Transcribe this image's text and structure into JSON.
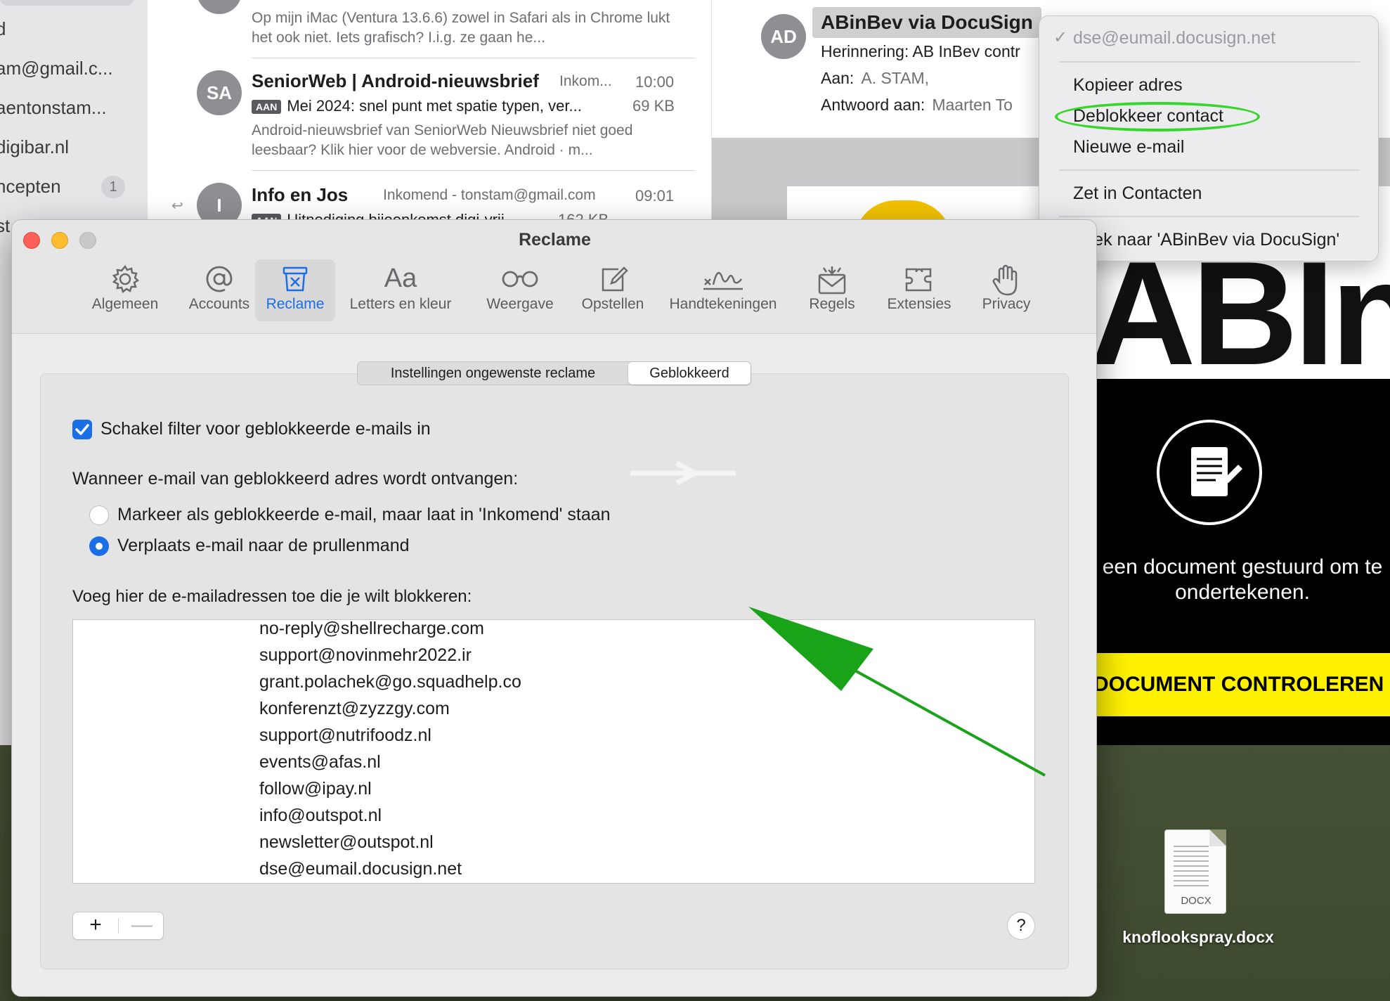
{
  "sidebar": {
    "items": [
      {
        "label": "d"
      },
      {
        "label": "am@gmail.c..."
      },
      {
        "label": "aentonstam..."
      },
      {
        "label": "digibar.nl"
      },
      {
        "label": "ncepten",
        "badge": "1"
      },
      {
        "label": "st"
      }
    ]
  },
  "mail_list": {
    "rows": [
      {
        "sender": "",
        "mailbox": "",
        "time": "",
        "subject": "",
        "size": "",
        "preview": "Op mijn iMac (Ventura 13.6.6) zowel in Safari als in Chrome lukt het ook niet. Iets grafisch? I.i.g. ze gaan he..."
      },
      {
        "avatar": "SA",
        "sender": "SeniorWeb | Android-nieuwsbrief",
        "mailbox": "Inkom...",
        "time": "10:00",
        "tag": "AAN",
        "subject": "Mei 2024: snel punt met spatie typen, ver...",
        "size": "69 KB",
        "preview": "Android-nieuwsbrief van SeniorWeb Nieuwsbrief niet goed leesbaar? Klik hier voor de webversie. Android · m..."
      },
      {
        "avatar": "I",
        "sender": "Info en Jos",
        "mailbox": "Inkomend - tonstam@gmail.com",
        "time": "09:01",
        "tag": "AAN",
        "subject": "Uitnodiging bijeenkomst digi-vrij...",
        "size": "162 KB"
      }
    ]
  },
  "message": {
    "avatar": "AD",
    "from": "ABinBev via DocuSign",
    "subject_label": "Herinnering: AB InBev contr",
    "to_label": "Aan:",
    "to_value": "A. STAM,",
    "reply_label": "Antwoord aan:",
    "reply_value": "Maarten To",
    "logo_text": "ABInE",
    "panel_text": "een document gestuurd om te ondertekenen.",
    "panel_button": "DOCUMENT CONTROLEREN"
  },
  "context_menu": {
    "address": "dse@eumail.docusign.net",
    "items": [
      "Kopieer adres",
      "Deblokkeer contact",
      "Nieuwe e-mail",
      "Zet in Contacten",
      "Zoek naar 'ABinBev via DocuSign'"
    ]
  },
  "desktop": {
    "file_type": "DOCX",
    "file_name": "knoflookspray.docx"
  },
  "prefs": {
    "title": "Reclame",
    "toolbar": [
      {
        "label": "Algemeen",
        "icon": "gear-icon"
      },
      {
        "label": "Accounts",
        "icon": "at-icon"
      },
      {
        "label": "Reclame",
        "icon": "junk-icon",
        "active": true
      },
      {
        "label": "Letters en kleur",
        "icon": "fonts-icon"
      },
      {
        "label": "Weergave",
        "icon": "glasses-icon"
      },
      {
        "label": "Opstellen",
        "icon": "compose-icon"
      },
      {
        "label": "Handtekeningen",
        "icon": "signature-icon"
      },
      {
        "label": "Regels",
        "icon": "rules-icon"
      },
      {
        "label": "Extensies",
        "icon": "puzzle-icon"
      },
      {
        "label": "Privacy",
        "icon": "hand-icon"
      }
    ],
    "segments": {
      "settings": "Instellingen ongewenste reclame",
      "blocked": "Geblokkeerd"
    },
    "filter_checkbox": {
      "label": "Schakel filter voor geblokkeerde e-mails in",
      "checked": true
    },
    "when_label": "Wanneer e-mail van geblokkeerd adres wordt ontvangen:",
    "radio_mark": "Markeer als geblokkeerde e-mail, maar laat in 'Inkomend' staan",
    "radio_move": "Verplaats e-mail naar de prullenmand",
    "selected_option": "radio_move",
    "list_label": "Voeg hier de e-mailadressen toe die je wilt blokkeren:",
    "blocked_addresses": [
      "no-reply@shellrecharge.com",
      "support@novinmehr2022.ir",
      "grant.polachek@go.squadhelp.co",
      "konferenzt@zyzzgy.com",
      "support@nutrifoodz.nl",
      "events@afas.nl",
      "follow@ipay.nl",
      "info@outspot.nl",
      "newsletter@outspot.nl",
      "dse@eumail.docusign.net"
    ],
    "add_button": "+",
    "remove_button": "—",
    "help_button": "?"
  },
  "colors": {
    "accent": "#1a6fe8",
    "annotation_green": "#19a318",
    "highlight_green": "#36d62c"
  }
}
